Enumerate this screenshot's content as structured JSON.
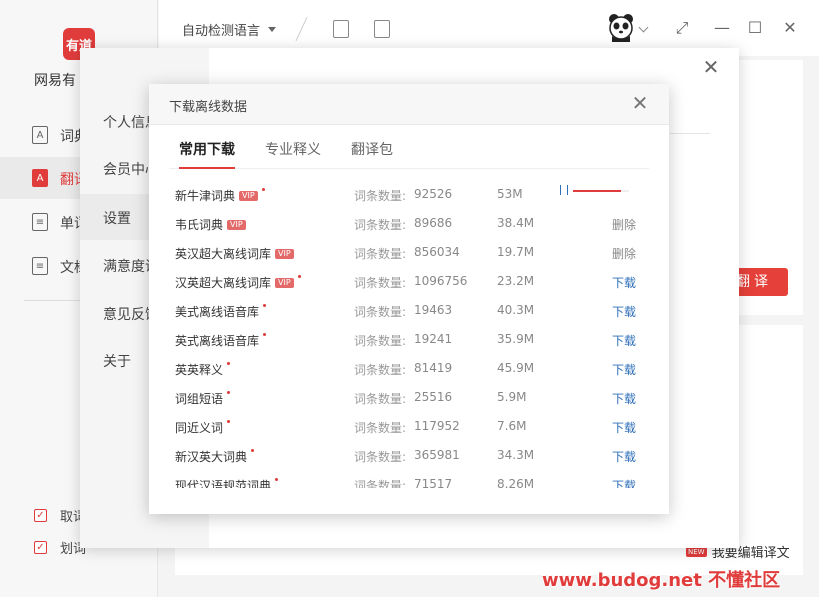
{
  "sidebar": {
    "logo_text": "有道",
    "app_name": "网易有",
    "items": [
      {
        "label": "词典",
        "icon": "dictionary-icon"
      },
      {
        "label": "翻译",
        "icon": "translate-icon"
      },
      {
        "label": "单词",
        "icon": "wordbook-icon"
      },
      {
        "label": "文档",
        "icon": "document-icon"
      }
    ],
    "checks": [
      {
        "label": "取词",
        "checked": true
      },
      {
        "label": "划词",
        "checked": true
      }
    ]
  },
  "toolbar": {
    "language": "自动检测语言"
  },
  "main": {
    "translate_button": "翻译",
    "edit_link": "我要编辑译文",
    "new_badge": "NEW"
  },
  "settings": {
    "nav": [
      "个人信息",
      "会员中心",
      "设置",
      "满意度调查",
      "意见反馈",
      "关于"
    ],
    "active_index": 2
  },
  "dialog": {
    "title": "下载离线数据",
    "tabs": [
      "常用下载",
      "专业释义",
      "翻译包"
    ],
    "count_label": "词条数量:",
    "rows": [
      {
        "name": "新牛津词典",
        "vip": true,
        "dot": true,
        "count": "92526",
        "size": "53M",
        "status": "downloading",
        "progress": 0.85
      },
      {
        "name": "韦氏词典",
        "vip": true,
        "dot": false,
        "count": "89686",
        "size": "38.4M",
        "status": "删除"
      },
      {
        "name": "英汉超大离线词库",
        "vip": true,
        "dot": false,
        "count": "856034",
        "size": "19.7M",
        "status": "删除"
      },
      {
        "name": "汉英超大离线词库",
        "vip": true,
        "dot": true,
        "count": "1096756",
        "size": "23.2M",
        "status": "下载"
      },
      {
        "name": "美式离线语音库",
        "vip": false,
        "dot": true,
        "count": "19463",
        "size": "40.3M",
        "status": "下载"
      },
      {
        "name": "英式离线语音库",
        "vip": false,
        "dot": true,
        "count": "19241",
        "size": "35.9M",
        "status": "下载"
      },
      {
        "name": "英英释义",
        "vip": false,
        "dot": true,
        "count": "81419",
        "size": "45.9M",
        "status": "下载"
      },
      {
        "name": "词组短语",
        "vip": false,
        "dot": true,
        "count": "25516",
        "size": "5.9M",
        "status": "下载"
      },
      {
        "name": "同近义词",
        "vip": false,
        "dot": true,
        "count": "117952",
        "size": "7.6M",
        "status": "下载"
      },
      {
        "name": "新汉英大词典",
        "vip": false,
        "dot": true,
        "count": "365981",
        "size": "34.3M",
        "status": "下载"
      },
      {
        "name": "现代汉语规范词典",
        "vip": false,
        "dot": true,
        "count": "71517",
        "size": "8.26M",
        "status": "下载"
      }
    ]
  },
  "watermark": "www.budog.net 不懂社区",
  "colors": {
    "accent": "#e03c3c",
    "link": "#2f6fb8"
  }
}
